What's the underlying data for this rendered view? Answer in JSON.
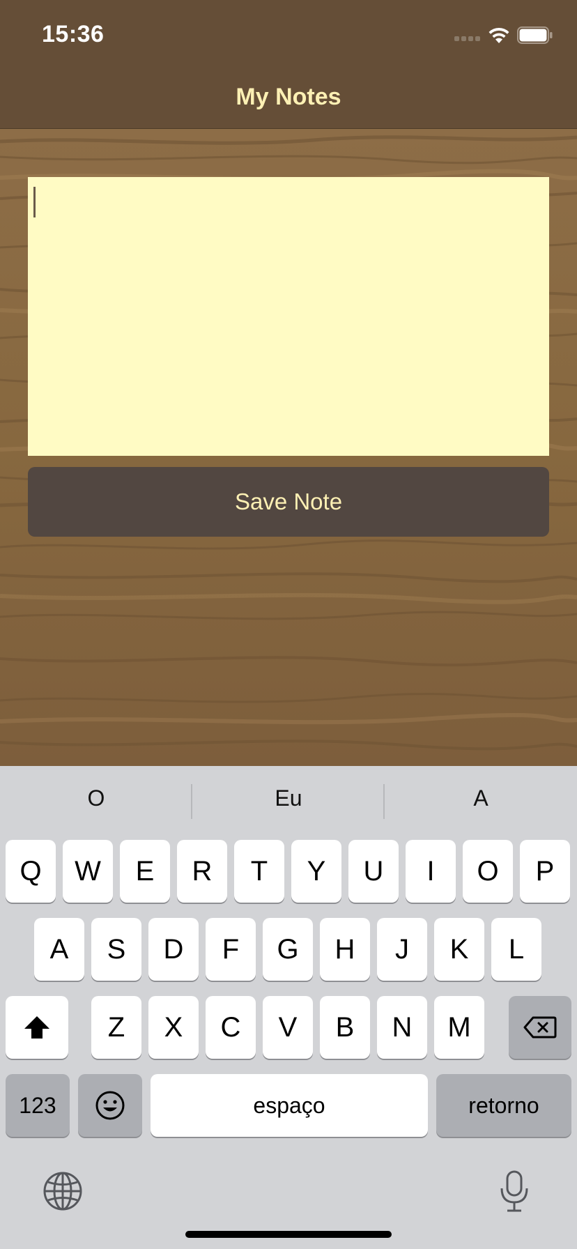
{
  "status_bar": {
    "time": "15:36"
  },
  "nav": {
    "title": "My Notes"
  },
  "note": {
    "value": "",
    "placeholder": ""
  },
  "save_button": {
    "label": "Save Note"
  },
  "keyboard": {
    "suggestions": [
      "O",
      "Eu",
      "A"
    ],
    "row1": [
      "Q",
      "W",
      "E",
      "R",
      "T",
      "Y",
      "U",
      "I",
      "O",
      "P"
    ],
    "row2": [
      "A",
      "S",
      "D",
      "F",
      "G",
      "H",
      "J",
      "K",
      "L"
    ],
    "row3": [
      "Z",
      "X",
      "C",
      "V",
      "B",
      "N",
      "M"
    ],
    "numbers_label": "123",
    "space_label": "espaço",
    "return_label": "retorno",
    "icons": {
      "shift": "shift-icon",
      "backspace": "backspace-icon",
      "emoji": "emoji-icon",
      "globe": "globe-icon",
      "microphone": "microphone-icon"
    }
  },
  "colors": {
    "bar": "#654e37",
    "title_text": "#fdf0b4",
    "note_bg": "#fffbc4",
    "button_bg": "#524741",
    "keyboard_bg": "#d2d3d6"
  }
}
